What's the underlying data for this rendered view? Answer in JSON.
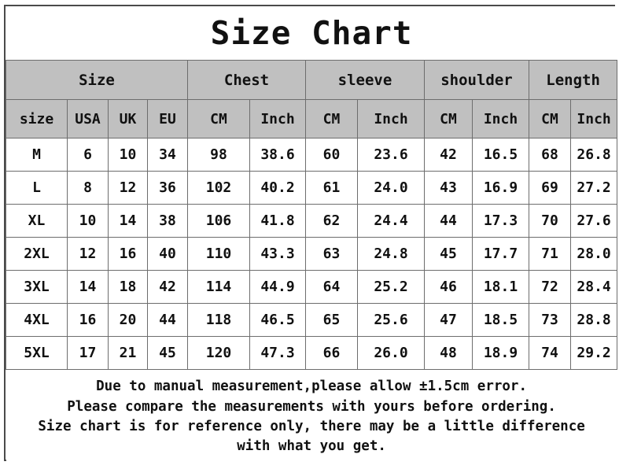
{
  "title": "Size Chart",
  "table": {
    "group_headers": [
      {
        "label": "Size",
        "span": 4
      },
      {
        "label": "Chest",
        "span": 2
      },
      {
        "label": "sleeve",
        "span": 2
      },
      {
        "label": "shoulder",
        "span": 2
      },
      {
        "label": "Length",
        "span": 2
      }
    ],
    "sub_headers": [
      "size",
      "USA",
      "UK",
      "EU",
      "CM",
      "Inch",
      "CM",
      "Inch",
      "CM",
      "Inch",
      "CM",
      "Inch"
    ],
    "rows": [
      [
        "M",
        "6",
        "10",
        "34",
        "98",
        "38.6",
        "60",
        "23.6",
        "42",
        "16.5",
        "68",
        "26.8"
      ],
      [
        "L",
        "8",
        "12",
        "36",
        "102",
        "40.2",
        "61",
        "24.0",
        "43",
        "16.9",
        "69",
        "27.2"
      ],
      [
        "XL",
        "10",
        "14",
        "38",
        "106",
        "41.8",
        "62",
        "24.4",
        "44",
        "17.3",
        "70",
        "27.6"
      ],
      [
        "2XL",
        "12",
        "16",
        "40",
        "110",
        "43.3",
        "63",
        "24.8",
        "45",
        "17.7",
        "71",
        "28.0"
      ],
      [
        "3XL",
        "14",
        "18",
        "42",
        "114",
        "44.9",
        "64",
        "25.2",
        "46",
        "18.1",
        "72",
        "28.4"
      ],
      [
        "4XL",
        "16",
        "20",
        "44",
        "118",
        "46.5",
        "65",
        "25.6",
        "47",
        "18.5",
        "73",
        "28.8"
      ],
      [
        "5XL",
        "17",
        "21",
        "45",
        "120",
        "47.3",
        "66",
        "26.0",
        "48",
        "18.9",
        "74",
        "29.2"
      ]
    ]
  },
  "note": {
    "lines": [
      "Due to manual measurement,please allow ±1.5cm error.",
      "Please compare the measurements with yours before ordering.",
      "Size chart is for reference only, there may be a little difference",
      "with what you get."
    ]
  },
  "colors": {
    "header_background": "#c0c0c0",
    "body_background": "#ffffff",
    "border": "#6d6d6d",
    "outer_border": "#4a4a4a",
    "text": "#111111"
  }
}
